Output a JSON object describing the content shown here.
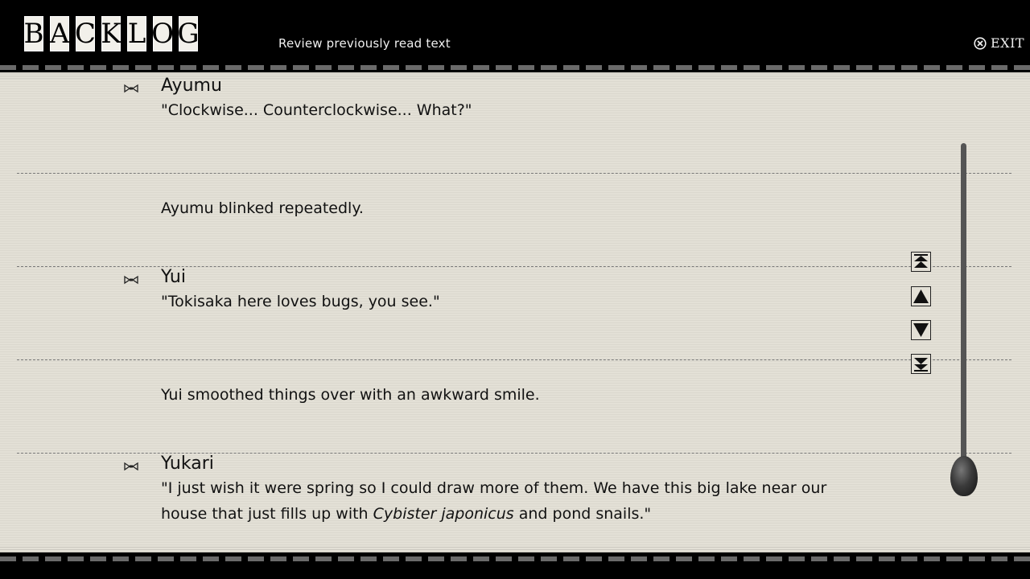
{
  "header": {
    "logo_letters": [
      "B",
      "A",
      "C",
      "K",
      "L",
      "O",
      "G"
    ],
    "subtitle": "Review previously read text",
    "exit_label": "EXIT",
    "exit_icon": "circle-x-icon"
  },
  "entries": [
    {
      "speaker": "Ayumu",
      "text": "\"Clockwise... Counterclockwise... What?\"",
      "has_voice": true
    },
    {
      "speaker": "",
      "text": "Ayumu blinked repeatedly.",
      "has_voice": false
    },
    {
      "speaker": "Yui",
      "text": "\"Tokisaka here loves bugs, you see.\"",
      "has_voice": true
    },
    {
      "speaker": "",
      "text": "Yui smoothed things over with an awkward smile.",
      "has_voice": false
    },
    {
      "speaker": "Yukari",
      "text_part1": "\"I just wish it were spring so I could draw more of them. We have this big lake near our house that just fills up with ",
      "text_italic": "Cybister japonicus",
      "text_part2": " and pond snails.\"",
      "has_voice": true
    }
  ],
  "scroll_controls": {
    "icons": [
      "double-up-arrow-icon",
      "up-arrow-icon",
      "down-arrow-icon",
      "double-down-arrow-icon"
    ]
  },
  "colors": {
    "paper": "#e3e0d6",
    "ink": "#111111",
    "header_bg": "#000000"
  }
}
